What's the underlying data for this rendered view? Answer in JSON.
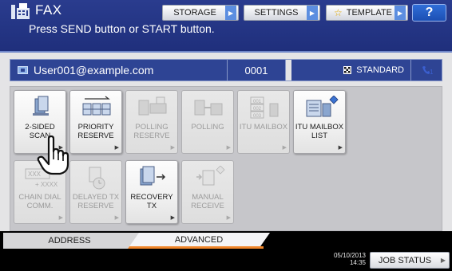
{
  "header": {
    "title": "FAX",
    "instruction": "Press SEND button or START button.",
    "storage_label": "STORAGE",
    "settings_label": "SETTINGS",
    "template_label": "TEMPLATE",
    "help_label": "?"
  },
  "destination": {
    "address": "User001@example.com",
    "count": "0001",
    "quality": "STANDARD",
    "line_icon": "phone-line-icon"
  },
  "functions": [
    {
      "label": "2-SIDED SCAN",
      "enabled": true,
      "icon": "two-sided-scan-icon"
    },
    {
      "label": "PRIORITY\nRESERVE",
      "enabled": true,
      "icon": "priority-reserve-icon"
    },
    {
      "label": "POLLING\nRESERVE",
      "enabled": false,
      "icon": "polling-reserve-icon"
    },
    {
      "label": "POLLING",
      "enabled": false,
      "icon": "polling-icon"
    },
    {
      "label": "ITU MAILBOX",
      "enabled": false,
      "icon": "itu-mailbox-icon"
    },
    {
      "label": "ITU MAILBOX\nLIST",
      "enabled": true,
      "icon": "itu-mailbox-list-icon"
    },
    {
      "label": "CHAIN DIAL\nCOMM.",
      "enabled": false,
      "icon": "chain-dial-icon"
    },
    {
      "label": "DELAYED TX\nRESERVE",
      "enabled": false,
      "icon": "delayed-tx-icon"
    },
    {
      "label": "RECOVERY\nTX",
      "enabled": true,
      "icon": "recovery-tx-icon"
    },
    {
      "label": "MANUAL\nRECEIVE",
      "enabled": false,
      "icon": "manual-receive-icon"
    }
  ],
  "tabs": [
    {
      "label": "ADDRESS",
      "active": false
    },
    {
      "label": "ADVANCED",
      "active": true
    }
  ],
  "footer": {
    "date": "05/10/2013",
    "time": "14:35",
    "job_status_label": "JOB STATUS"
  },
  "colors": {
    "header_blue": "#1f2f7c",
    "dest_bar_blue": "#2e4494",
    "active_tab_accent": "#f0862b",
    "help_blue": "#1c4fb3"
  }
}
